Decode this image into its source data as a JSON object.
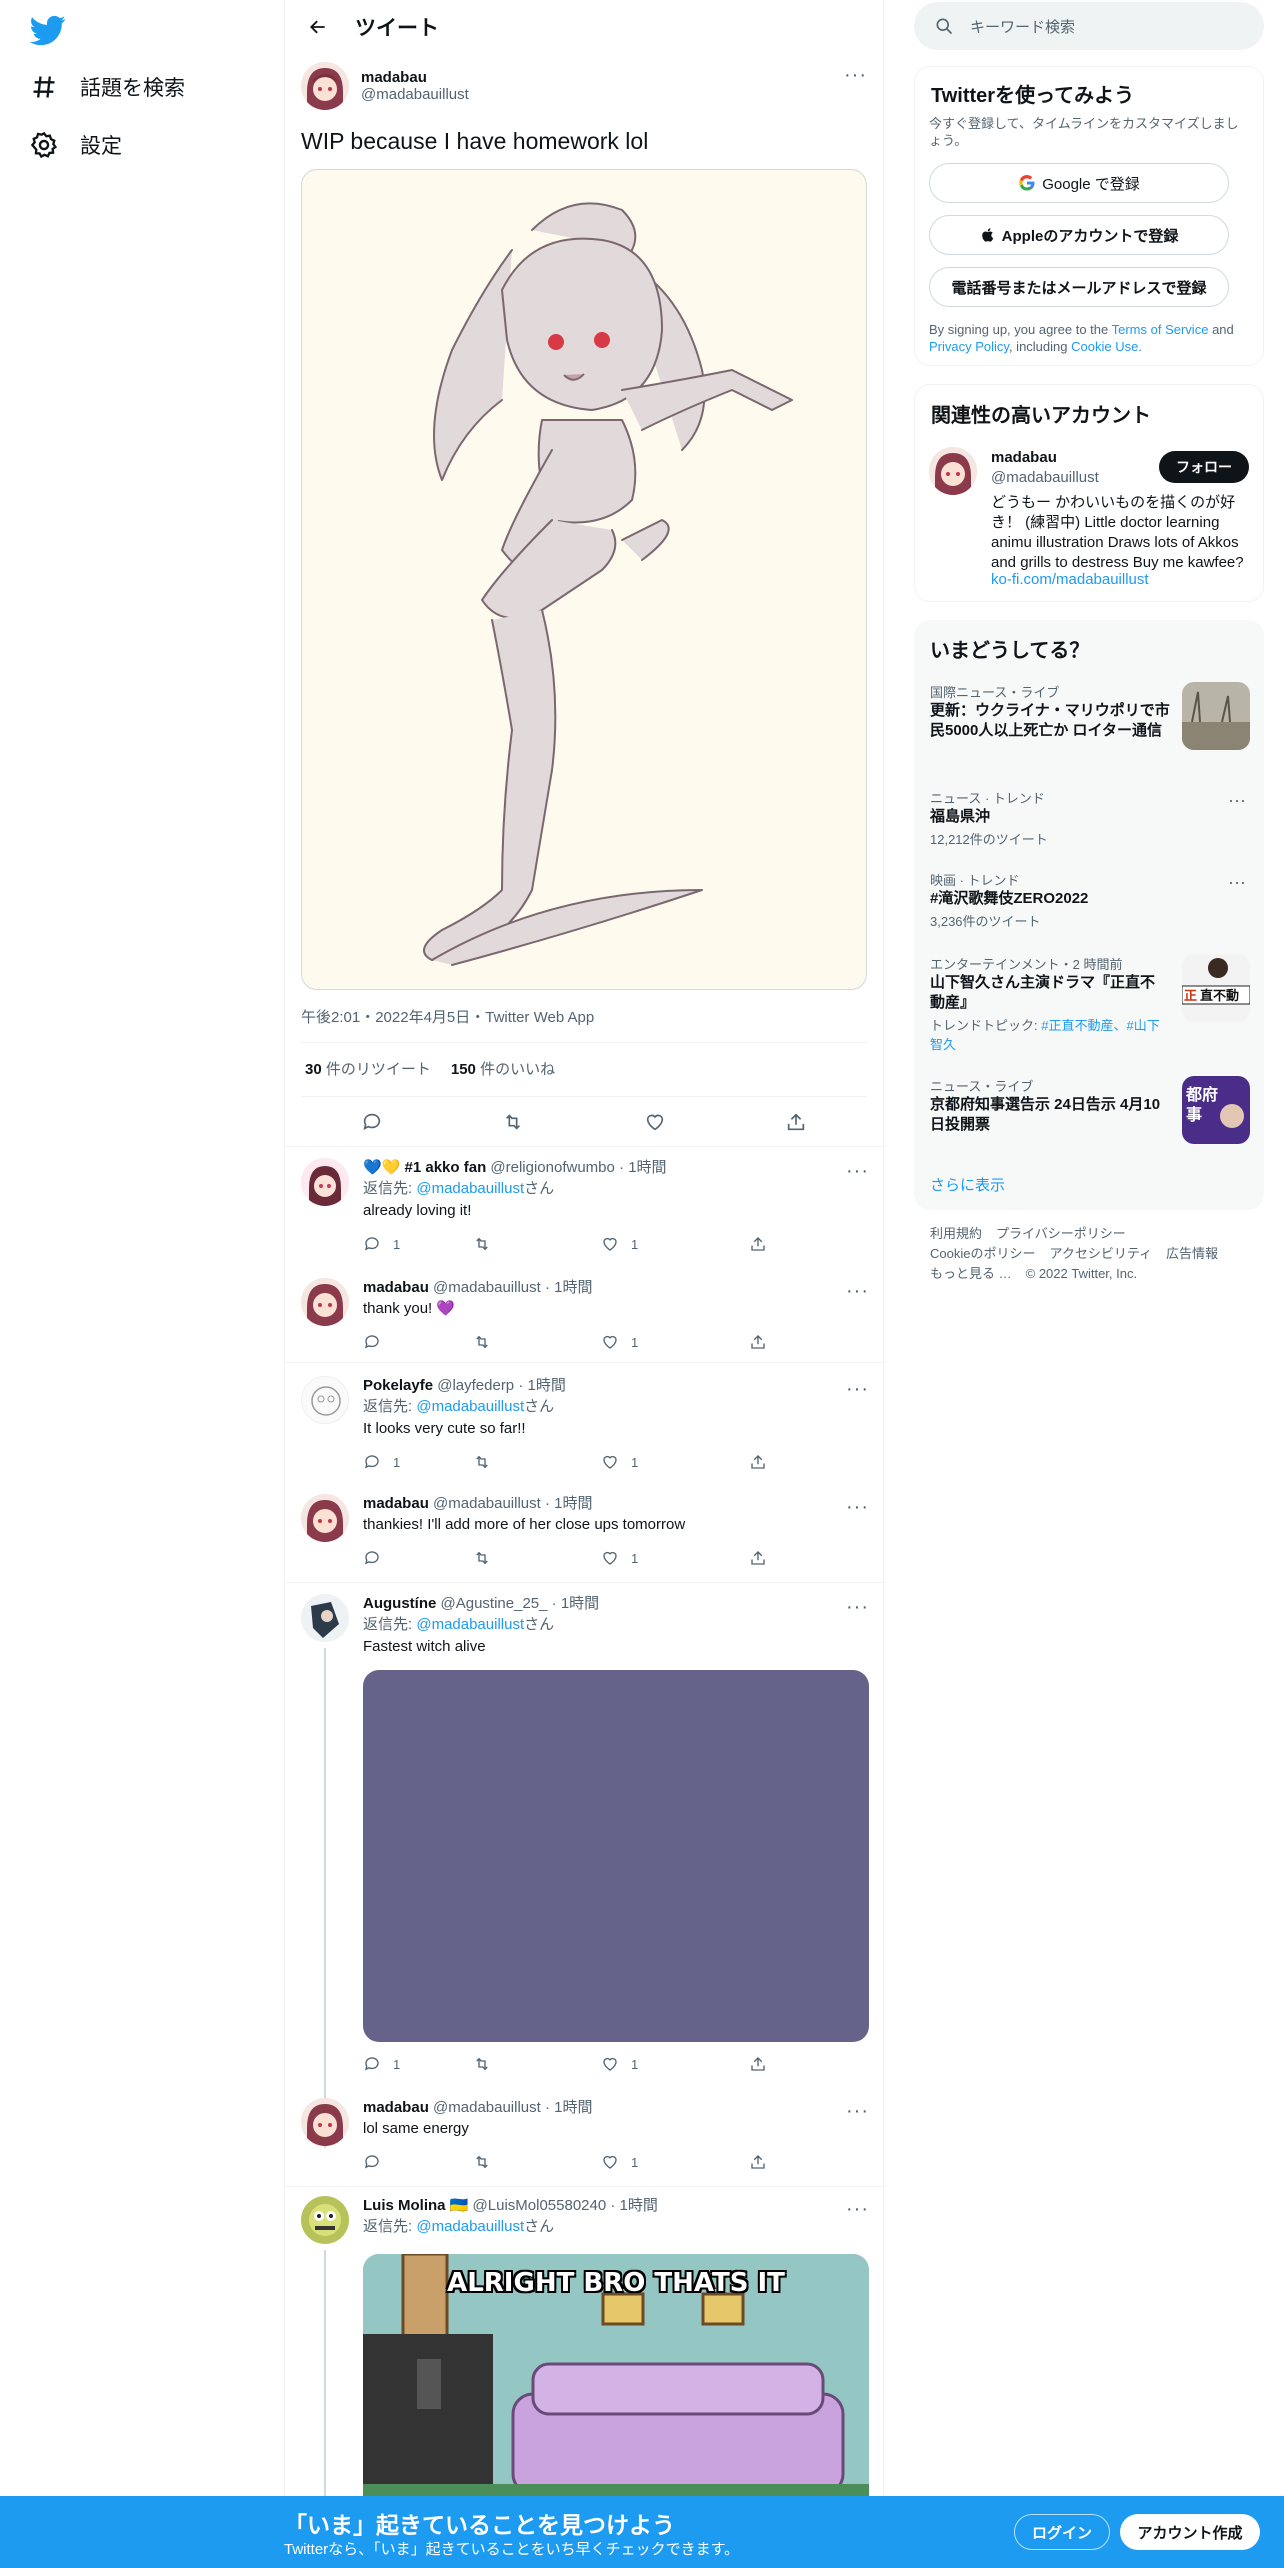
{
  "nav": {
    "explore_label": "話題を検索",
    "settings_label": "設定"
  },
  "header": {
    "title": "ツイート"
  },
  "tweet": {
    "name": "madabau",
    "handle": "@madabauillust",
    "text": "WIP because I have homework lol",
    "meta": "午後2:01・2022年4月5日・Twitter Web App",
    "retweets": "30",
    "retweets_label": "件のリツイート",
    "likes": "150",
    "likes_label": "件のいいね"
  },
  "replies": [
    {
      "name": "💙💛 #1 akko fan",
      "handle": "@religionofwumbo",
      "time": "· 1時間",
      "reply_to_prefix": "返信先:",
      "reply_to": "@madabauillust",
      "reply_to_suffix": "さん",
      "text": "already loving it!",
      "replies": "1",
      "retweets": "",
      "likes": "1"
    },
    {
      "name": "madabau",
      "handle": "@madabauillust",
      "time": "· 1時間",
      "text": "thank you! 💜",
      "replies": "",
      "retweets": "",
      "likes": "1"
    },
    {
      "name": "Pokelayfe",
      "handle": "@layfederp",
      "time": "· 1時間",
      "reply_to_prefix": "返信先:",
      "reply_to": "@madabauillust",
      "reply_to_suffix": "さん",
      "text": "It looks very cute so far!!",
      "replies": "1",
      "retweets": "",
      "likes": "1"
    },
    {
      "name": "madabau",
      "handle": "@madabauillust",
      "time": "· 1時間",
      "text": "thankies! I'll add more of her close ups tomorrow",
      "replies": "",
      "retweets": "",
      "likes": "1"
    },
    {
      "name": "Augustíne",
      "handle": "@Agustine_25_",
      "time": "· 1時間",
      "reply_to_prefix": "返信先:",
      "reply_to": "@madabauillust",
      "reply_to_suffix": "さん",
      "text": "Fastest witch alive",
      "replies": "1",
      "retweets": "",
      "likes": "1"
    },
    {
      "name": "madabau",
      "handle": "@madabauillust",
      "time": "· 1時間",
      "text": "lol same energy",
      "replies": "",
      "retweets": "",
      "likes": "1"
    },
    {
      "name": "Luis Molina 🇺🇦",
      "handle": "@LuisMol05580240",
      "time": "· 1時間",
      "reply_to_prefix": "返信先:",
      "reply_to": "@madabauillust",
      "reply_to_suffix": "さん",
      "meme_text": "ALRIGHT BRO THATS IT"
    }
  ],
  "sidebar": {
    "search_placeholder": "キーワード検索",
    "signup": {
      "title": "Twitterを使ってみよう",
      "subtitle": "今すぐ登録して、タイムラインをカスタマイズしましょう。",
      "google": "Google で登録",
      "apple": "Appleのアカウントで登録",
      "phone": "電話番号またはメールアドレスで登録",
      "legal_1": "By signing up, you agree to the",
      "terms": "Terms of Service",
      "and": "and",
      "privacy": "Privacy Policy",
      "including": ", including",
      "cookie": "Cookie Use."
    },
    "related": {
      "title": "関連性の高いアカウント",
      "name": "madabau",
      "handle": "@madabauillust",
      "follow": "フォロー",
      "bio": "どうもー かわいいものを描くのが好き！ (練習中) Little doctor learning animu illustration Draws lots of Akkos and grills to destress Buy me kawfee?",
      "link": "ko-fi.com/madabauillust"
    },
    "trends": {
      "title": "いまどうしてる？",
      "items": [
        {
          "category": "国際ニュース・ライブ",
          "name": "更新：ウクライナ・マリウポリで市民5000人以上死亡か ロイター通信"
        },
        {
          "category": "ニュース · トレンド",
          "name": "福島県沖",
          "count": "12,212件のツイート"
        },
        {
          "category": "映画 · トレンド",
          "name": "#滝沢歌舞伎ZERO2022",
          "count": "3,236件のツイート"
        },
        {
          "category": "エンターテインメント・2 時間前",
          "name": "山下智久さん主演ドラマ『正直不動産』",
          "topic_prefix": "トレンドトピック:",
          "topic": "#正直不動産、#山下智久"
        },
        {
          "category": "ニュース・ライブ",
          "name": "京都府知事選告示 24日告示 4月10日投開票"
        }
      ],
      "more": "さらに表示"
    },
    "footer": {
      "links": [
        "利用規約",
        "プライバシーポリシー",
        "Cookieのポリシー",
        "アクセシビリティ",
        "広告情報",
        "もっと見る …"
      ],
      "copyright": "© 2022 Twitter, Inc."
    }
  },
  "bottom": {
    "title": "「いま」起きていることを見つけよう",
    "subtitle": "Twitterなら、「いま」起きていることをいち早くチェックできます。",
    "login": "ログイン",
    "signup": "アカウント作成"
  },
  "colors": {
    "accent": "#1d9bf0",
    "text": "#0f1419",
    "muted": "#536471"
  }
}
